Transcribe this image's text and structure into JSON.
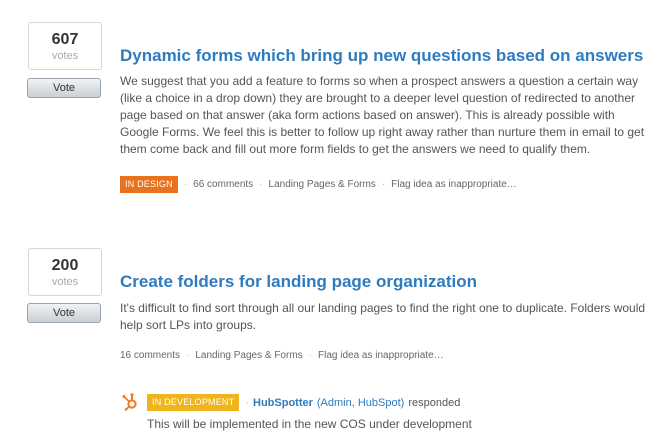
{
  "ideas": [
    {
      "votes": "607",
      "votes_label": "votes",
      "vote_button": "Vote",
      "title": "Dynamic forms which bring up new questions based on answers",
      "description": "We suggest that you add a feature to forms so when a prospect answers a question a certain way (like a choice in a drop down) they are brought to a deeper level question of redirected to another page based on that answer (aka form actions based on answer). This is already possible with Google Forms. We feel this is better to follow up right away rather than nurture them in email to get them come back and fill out more form fields to get the answers we need to qualify them.",
      "status": "IN DESIGN",
      "status_color": "#e8731f",
      "comments": "66 comments",
      "category": "Landing Pages & Forms",
      "flag": "Flag idea as inappropriate…"
    },
    {
      "votes": "200",
      "votes_label": "votes",
      "vote_button": "Vote",
      "title": "Create folders for landing page organization",
      "description": "It's difficult to find sort through all our landing pages to find the right one to duplicate. Folders would help sort LPs into groups.",
      "comments": "16 comments",
      "category": "Landing Pages & Forms",
      "flag": "Flag idea as inappropriate…",
      "response": {
        "avatar_icon": "hubspot-sprocket-icon",
        "status": "IN DEVELOPMENT",
        "status_color": "#f0b51b",
        "responder": "HubSpotter",
        "role": "(Admin, HubSpot)",
        "action": "responded",
        "text": "This will be implemented in the new COS under development"
      }
    }
  ]
}
